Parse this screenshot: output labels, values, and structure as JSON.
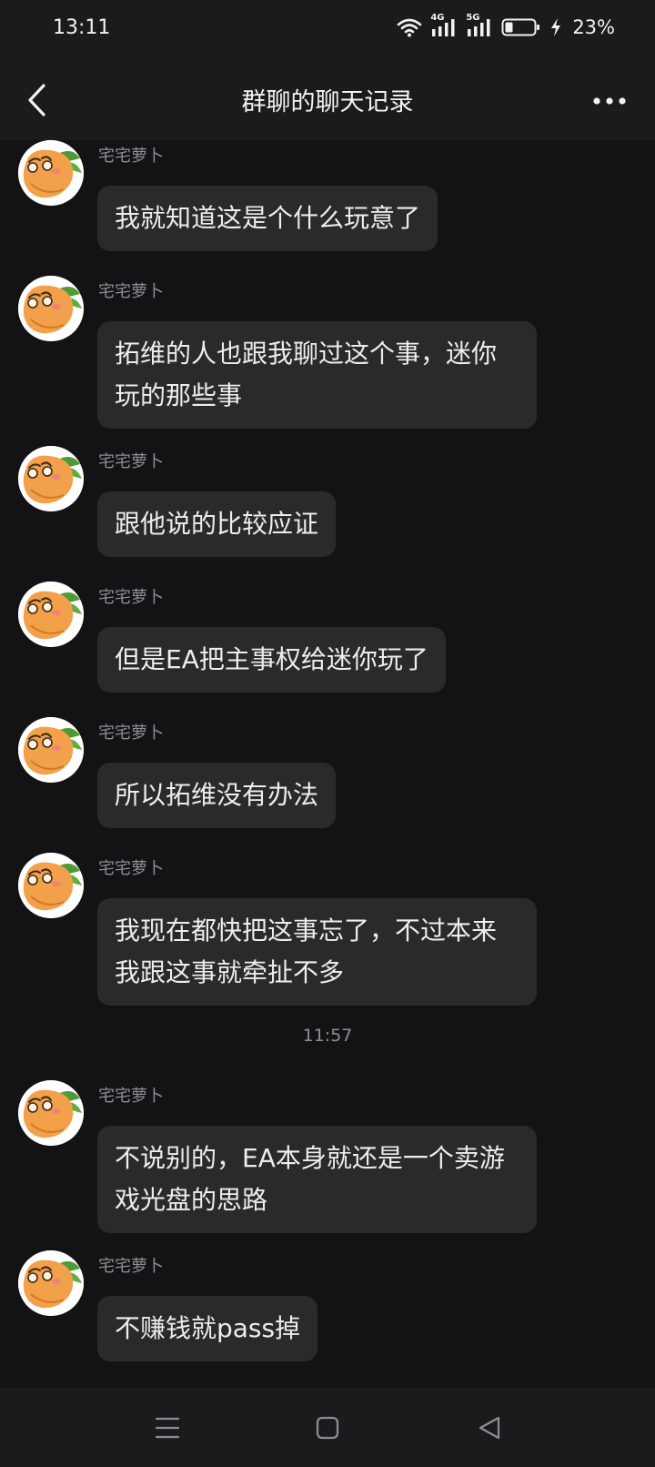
{
  "status_bar": {
    "time": "13:11",
    "network_1": "4G",
    "network_2": "5G",
    "battery_percent": "23%"
  },
  "header": {
    "title": "群聊的聊天记录",
    "back_icon": "chevron-left-icon",
    "more_icon": "more-horizontal-icon"
  },
  "messages": [
    {
      "sender": "宅宅萝卜",
      "text": "我就知道这是个什么玩意了"
    },
    {
      "sender": "宅宅萝卜",
      "text": "拓维的人也跟我聊过这个事，迷你玩的那些事"
    },
    {
      "sender": "宅宅萝卜",
      "text": "跟他说的比较应证"
    },
    {
      "sender": "宅宅萝卜",
      "text": "但是EA把主事权给迷你玩了"
    },
    {
      "sender": "宅宅萝卜",
      "text": "所以拓维没有办法"
    },
    {
      "sender": "宅宅萝卜",
      "text": "我现在都快把这事忘了，不过本来我跟这事就牵扯不多"
    },
    {
      "sender": "宅宅萝卜",
      "text": "不说别的，EA本身就还是一个卖游戏光盘的思路"
    },
    {
      "sender": "宅宅萝卜",
      "text": "不赚钱就pass掉"
    }
  ],
  "timestamp": "11:57",
  "bottom_nav": {
    "menu_icon": "menu-icon",
    "home_icon": "home-square-icon",
    "back_icon": "back-triangle-icon"
  },
  "colors": {
    "background": "#131315",
    "bars": "#1b1b1d",
    "bubble": "#2a2a2d",
    "muted_text": "#8e8e93",
    "avatar_orange": "#f2a04a",
    "avatar_leaf": "#4f9a35"
  }
}
